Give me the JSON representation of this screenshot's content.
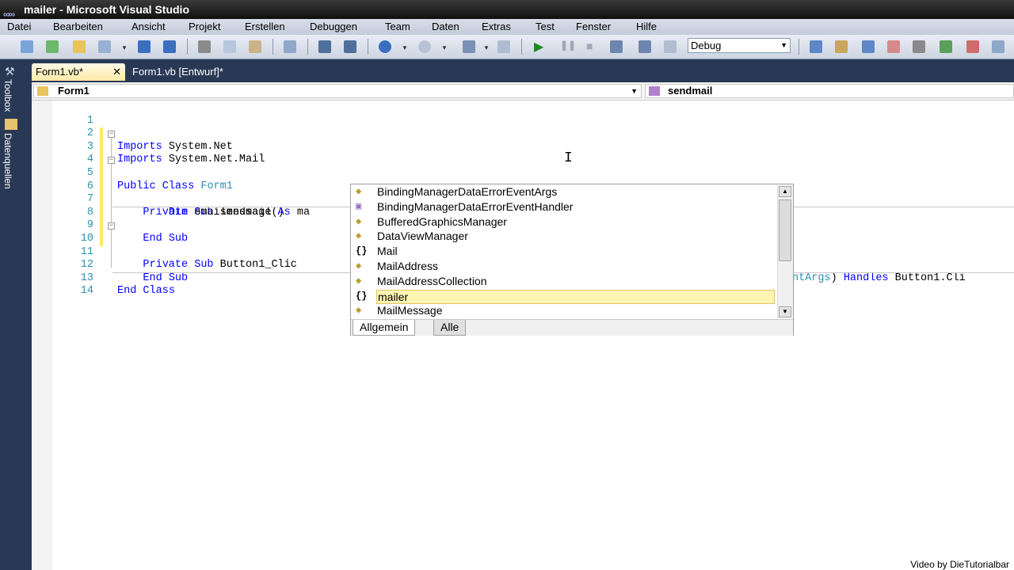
{
  "window": {
    "title": "mailer - Microsoft Visual Studio"
  },
  "menu": [
    "Datei",
    "Bearbeiten",
    "Ansicht",
    "Projekt",
    "Erstellen",
    "Debuggen",
    "Team",
    "Daten",
    "Extras",
    "Test",
    "Fenster",
    "Hilfe"
  ],
  "toolbar": {
    "config_value": "Debug"
  },
  "side_tabs": {
    "toolbox": "Toolbox",
    "datasources": "Datenquellen"
  },
  "tabs": [
    {
      "label": "Form1.vb*",
      "active": true
    },
    {
      "label": "Form1.vb [Entwurf]*",
      "active": false
    }
  ],
  "nav": {
    "class_combo": "Form1",
    "member_combo": "sendmail"
  },
  "code_lines": [
    {
      "num": "1",
      "text": "Imports System.Net"
    },
    {
      "num": "2",
      "text": "Imports System.Net.Mail"
    },
    {
      "num": "3",
      "text": "Public Class Form1"
    },
    {
      "num": "4",
      "text": ""
    },
    {
      "num": "5",
      "text": "    Private Sub sendmail()"
    },
    {
      "num": "6",
      "text": "        Dim emailmessage As ma"
    },
    {
      "num": "7",
      "text": ""
    },
    {
      "num": "8",
      "text": "    End Sub"
    },
    {
      "num": "9",
      "text": ""
    },
    {
      "num": "10",
      "text": "    Private Sub Button1_Clic"
    },
    {
      "num": "11",
      "text": ""
    },
    {
      "num": "12",
      "text": "    End Sub"
    },
    {
      "num": "13",
      "text": "End Class"
    },
    {
      "num": "14",
      "text": ""
    }
  ],
  "line10_tail": {
    "type": "ntArgs",
    "rest": ") Handles Button1.Cli"
  },
  "intellisense": {
    "items": [
      {
        "label": "BindingManagerDataErrorEventArgs",
        "icon": "class-icon"
      },
      {
        "label": "BindingManagerDataErrorEventHandler",
        "icon": "delegate-icon"
      },
      {
        "label": "BufferedGraphicsManager",
        "icon": "class-icon"
      },
      {
        "label": "DataViewManager",
        "icon": "class-icon"
      },
      {
        "label": "Mail",
        "icon": "namespace-icon"
      },
      {
        "label": "MailAddress",
        "icon": "class-icon"
      },
      {
        "label": "MailAddressCollection",
        "icon": "class-icon"
      },
      {
        "label": "mailer",
        "icon": "namespace-icon",
        "selected": true
      },
      {
        "label": "MailMessage",
        "icon": "class-icon"
      }
    ],
    "tab_common": "Allgemein",
    "tab_all": "Alle"
  },
  "watermark": "Video by DieTutorialbar"
}
